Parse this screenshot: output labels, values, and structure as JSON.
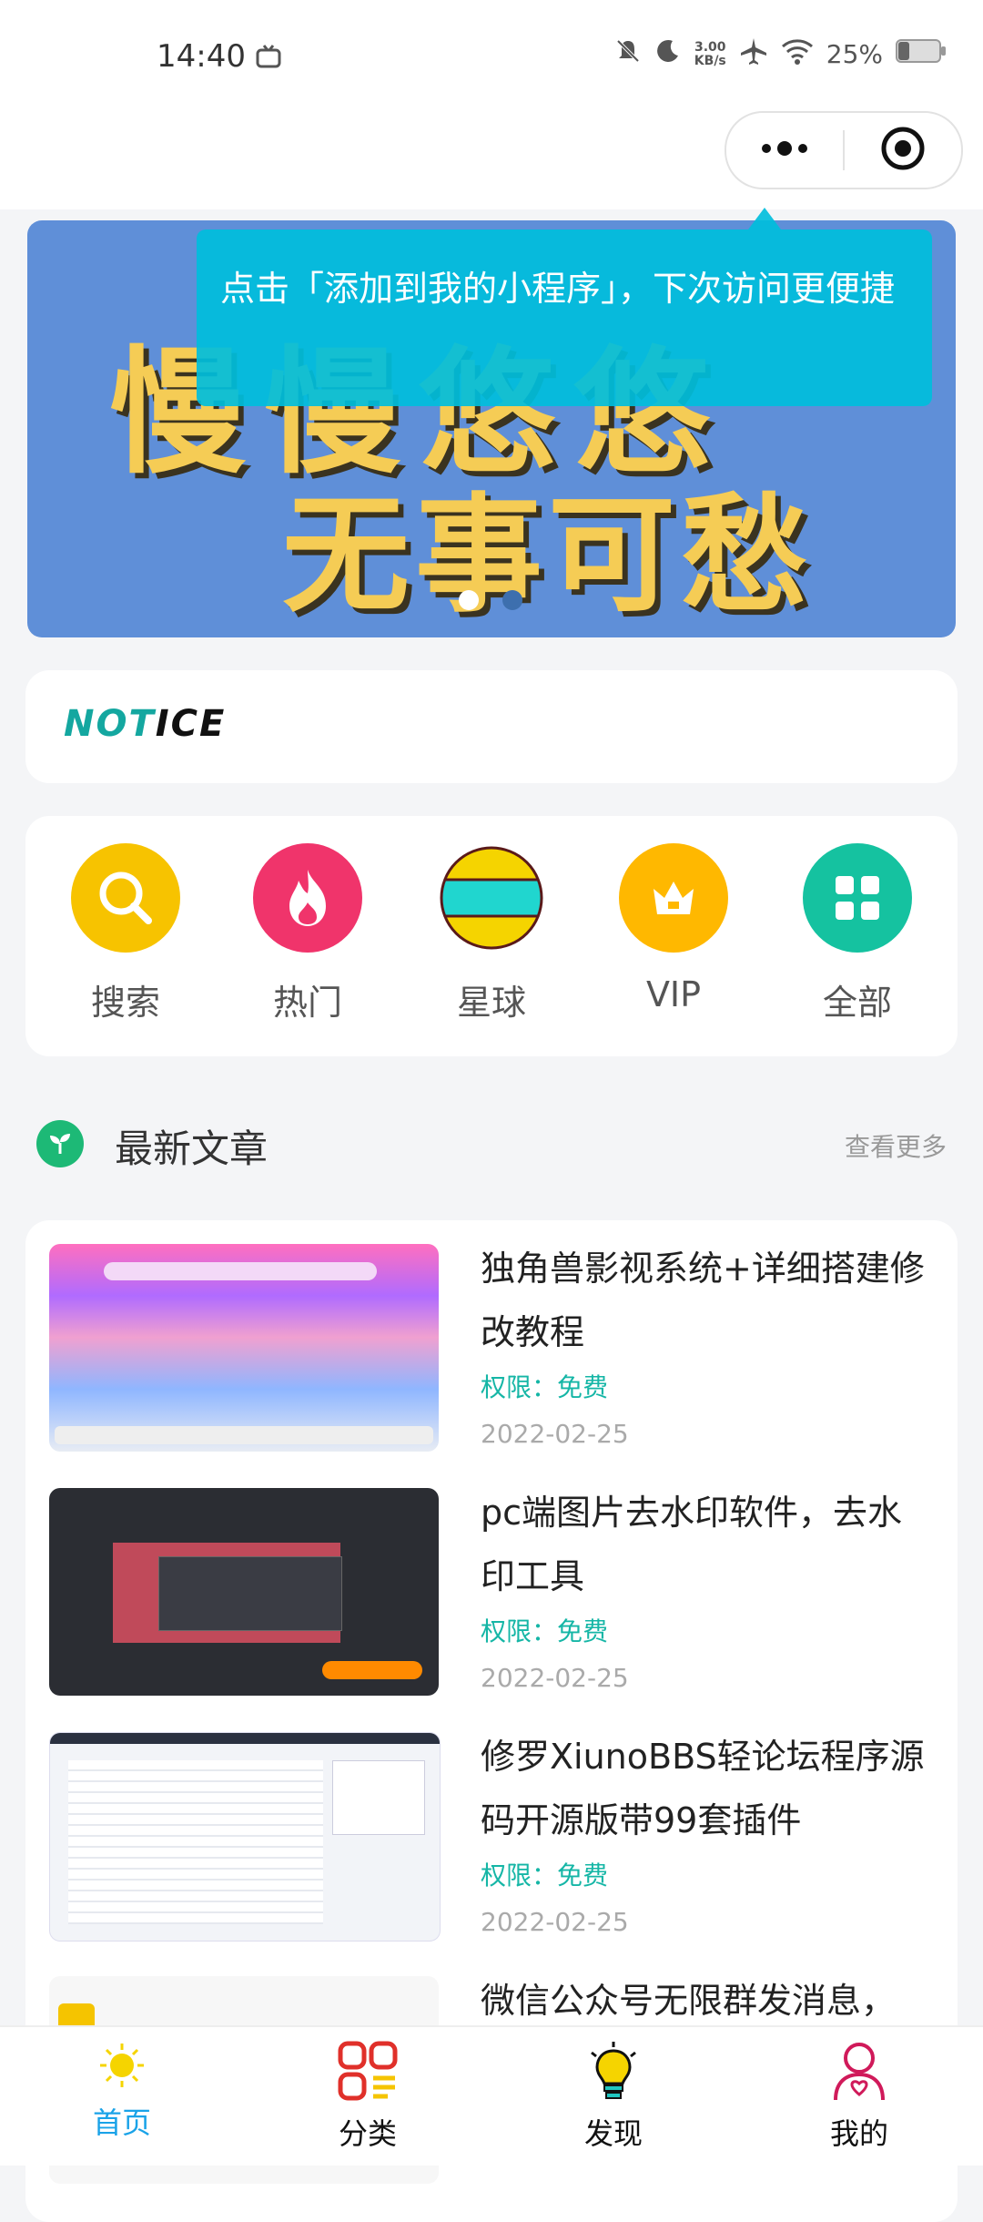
{
  "status_bar": {
    "time": "14:40",
    "network_speed_value": "3.00",
    "network_speed_unit": "KB/s",
    "battery": "25%"
  },
  "banner": {
    "line1": "慢慢悠悠",
    "line2": "无事可愁",
    "active_slide": 1,
    "slide_count": 2
  },
  "tooltip": {
    "text": "点击「添加到我的小程序」，下次访问更便捷"
  },
  "notice": {
    "logo_part1": "NOT",
    "logo_part2": "ICE"
  },
  "nav": [
    {
      "label": "搜索",
      "icon": "search-icon",
      "color": "#f7c300"
    },
    {
      "label": "热门",
      "icon": "fire-icon",
      "color": "#f0346b"
    },
    {
      "label": "星球",
      "icon": "planet-icon",
      "color": "#20d6cf"
    },
    {
      "label": "VIP",
      "icon": "crown-icon",
      "color": "#ffb800"
    },
    {
      "label": "全部",
      "icon": "grid-icon",
      "color": "#15c2a0"
    }
  ],
  "section": {
    "title": "最新文章",
    "more": "查看更多"
  },
  "articles": [
    {
      "title": "独角兽影视系统+详细搭建修改教程",
      "permission": "权限：免费",
      "date": "2022-02-25"
    },
    {
      "title": "pc端图片去水印软件，去水印工具",
      "permission": "权限：免费",
      "date": "2022-02-25"
    },
    {
      "title": "修罗XiunoBBS轻论坛程序源码开源版带99套插件",
      "permission": "权限：免费",
      "date": "2022-02-25"
    },
    {
      "title": "微信公众号无限群发消息，",
      "permission": "",
      "date": ""
    }
  ],
  "tabbar": [
    {
      "label": "首页",
      "icon": "sun-icon",
      "active": true
    },
    {
      "label": "分类",
      "icon": "category-icon",
      "active": false
    },
    {
      "label": "发现",
      "icon": "bulb-icon",
      "active": false
    },
    {
      "label": "我的",
      "icon": "user-icon",
      "active": false
    }
  ],
  "colors": {
    "accent": "#15b6a6",
    "tab_active": "#1aa3e8",
    "banner_bg": "#5f8fd8",
    "tooltip_bg": "#00bedc"
  }
}
